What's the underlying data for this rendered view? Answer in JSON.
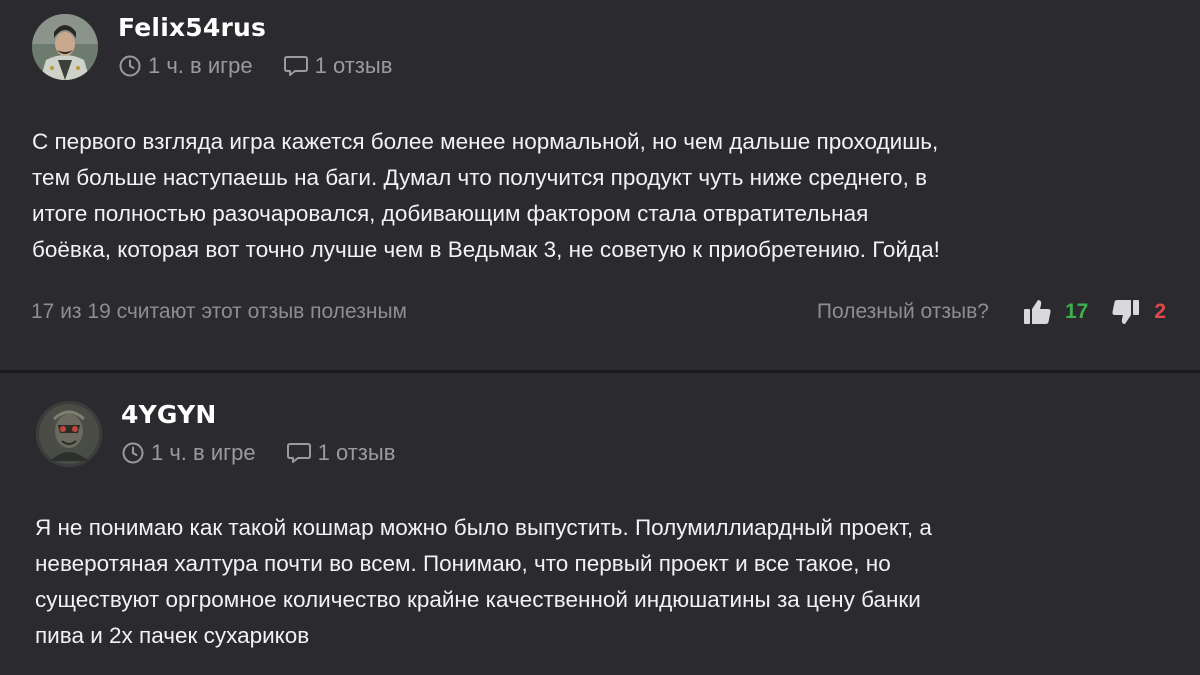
{
  "reviews": [
    {
      "username": "Felix54rus",
      "hours": "1 ч. в игре",
      "reviews_count": "1 отзыв",
      "body": [
        "С первого взгляда игра кажется более менее нормальной, но чем дальше проходишь,",
        "тем больше наступаешь на баги. Думал что получится продукт чуть ниже среднего, в",
        "итоге полностью разочаровался, добивающим фактором стала отвратительная",
        "боёвка, которая вот точно лучше чем в Ведьмак 3, не советую к приобретению. Гойда!"
      ],
      "helpful_summary": "17 из 19 считают этот отзыв полезным",
      "helpful_question": "Полезный отзыв?",
      "likes": "17",
      "dislikes": "2"
    },
    {
      "username": "4YGYN",
      "hours": "1 ч. в игре",
      "reviews_count": "1 отзыв",
      "body": [
        "Я не понимаю как такой кошмар можно было выпустить. Полумиллиардный проект, а",
        "неверотяная халтура почти во всем. Понимаю, что первый проект и все такое, но",
        "существуют оргромное количество крайне качественной индюшатины за цену банки",
        "пива и 2х пачек сухариков"
      ]
    }
  ],
  "icons": {
    "clock": "clock-icon",
    "comment": "comment-icon",
    "thumbs_up": "thumbs-up-icon",
    "thumbs_down": "thumbs-down-icon"
  },
  "colors": {
    "background": "#2b2b2f",
    "likes": "#3fae4e",
    "dislikes": "#e04a4a"
  }
}
